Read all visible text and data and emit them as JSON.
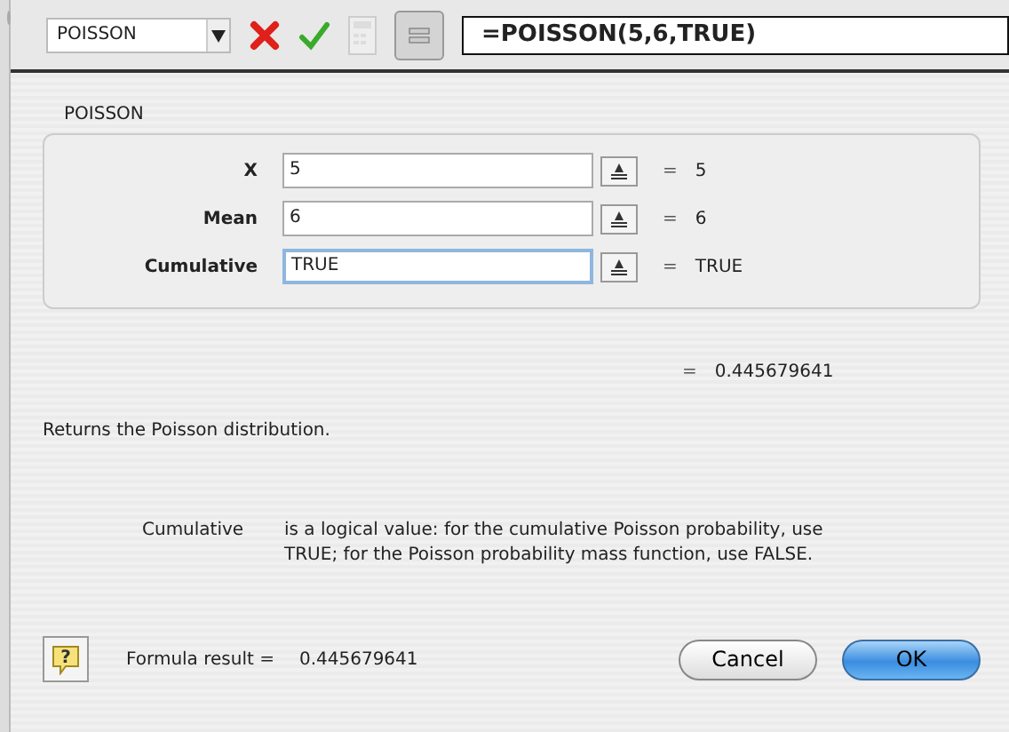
{
  "formula_bar": {
    "function_name": "POISSON",
    "formula": "=POISSON(5,6,TRUE)"
  },
  "group": {
    "title": "POISSON",
    "args": [
      {
        "label": "X",
        "value": "5",
        "equals": "=",
        "result": "5",
        "focused": false
      },
      {
        "label": "Mean",
        "value": "6",
        "equals": "=",
        "result": "6",
        "focused": false
      },
      {
        "label": "Cumulative",
        "value": "TRUE",
        "equals": "=",
        "result": "TRUE",
        "focused": true
      }
    ]
  },
  "function_result": {
    "equals": "=",
    "value": "0.445679641"
  },
  "description": "Returns the Poisson distribution.",
  "arg_help": {
    "name": "Cumulative",
    "text": "is a logical value: for the cumulative Poisson probability, use TRUE; for the Poisson probability mass function, use FALSE."
  },
  "footer": {
    "help_glyph": "?",
    "result_label": "Formula result =",
    "result_value": "0.445679641",
    "buttons": [
      {
        "label": "Cancel",
        "default": false
      },
      {
        "label": "OK",
        "default": true
      }
    ]
  }
}
